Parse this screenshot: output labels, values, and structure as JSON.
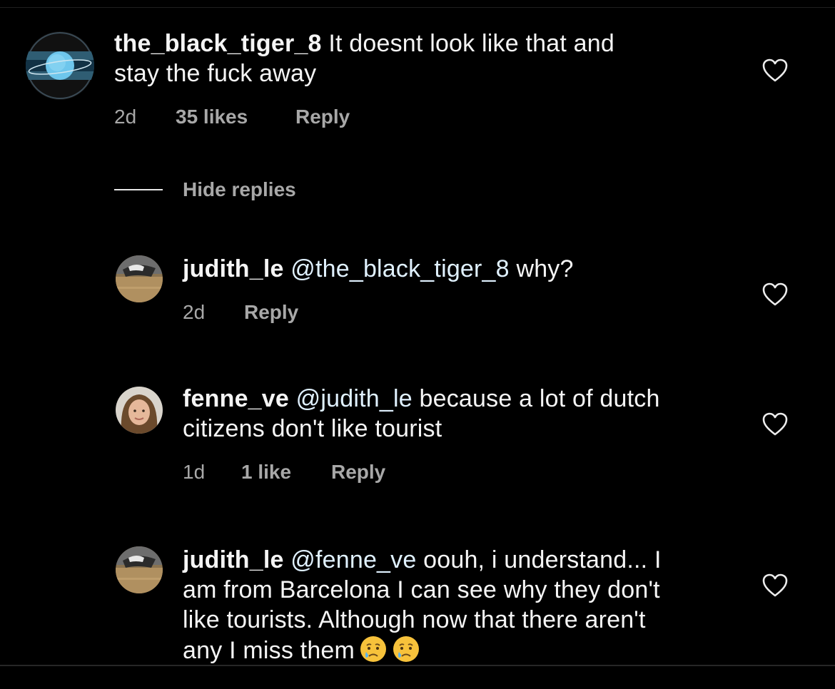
{
  "comments": [
    {
      "username": "the_black_tiger_8",
      "text_lines": [
        "It doesnt look like that and",
        "stay the fuck away"
      ],
      "time": "2d",
      "likes": "35 likes",
      "reply": "Reply",
      "avatar_icon": "planet-avatar"
    },
    {
      "username": "judith_le",
      "mention": "@the_black_tiger_8",
      "text": "why?",
      "time": "2d",
      "reply": "Reply",
      "avatar_icon": "cat-photo-avatar"
    },
    {
      "username": "fenne_ve",
      "mention": "@judith_le",
      "text_line1": "because a lot of dutch",
      "text_line2": "citizens don't like tourist",
      "time": "1d",
      "likes": "1 like",
      "reply": "Reply",
      "avatar_icon": "person-photo-avatar"
    },
    {
      "username": "judith_le",
      "mention": "@fenne_ve",
      "text_line1": "oouh, i understand... I",
      "text_line2": "am from Barcelona I can see why they don't",
      "text_line3": "like tourists. Although now that there aren't",
      "text_line4": "any I miss them",
      "emoji": "crying-face-emoji",
      "avatar_icon": "cat-photo-avatar"
    }
  ],
  "hide_replies_label": "Hide replies",
  "colors": {
    "background": "#000000",
    "text": "#f5f5f5",
    "meta": "#a8a8a8",
    "mention": "#e0f1ff"
  }
}
